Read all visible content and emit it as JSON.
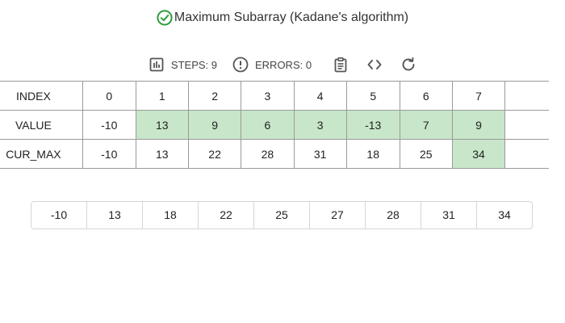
{
  "title": {
    "text": "Maximum Subarray (Kadane's algorithm)",
    "icon": "check-circle-icon",
    "icon_color": "#2e9b3a"
  },
  "toolbar": {
    "steps_label": "STEPS: 9",
    "errors_label": "ERRORS: 0",
    "icons": [
      "bar-chart-icon",
      "alert-circle-icon",
      "clipboard-icon",
      "code-icon",
      "refresh-icon"
    ]
  },
  "table": {
    "rows": [
      {
        "label": "INDEX",
        "cells": [
          "0",
          "1",
          "2",
          "3",
          "4",
          "5",
          "6",
          "7"
        ],
        "highlight": []
      },
      {
        "label": "VALUE",
        "cells": [
          "-10",
          "13",
          "9",
          "6",
          "3",
          "-13",
          "7",
          "9"
        ],
        "highlight": [
          1,
          2,
          3,
          4,
          5,
          6,
          7
        ]
      },
      {
        "label": "CUR_MAX",
        "cells": [
          "-10",
          "13",
          "22",
          "28",
          "31",
          "18",
          "25",
          "34"
        ],
        "highlight": [
          7
        ]
      }
    ],
    "highlight_color": "#c8e6c9"
  },
  "sorted_values": [
    "-10",
    "13",
    "18",
    "22",
    "25",
    "27",
    "28",
    "31",
    "34"
  ]
}
